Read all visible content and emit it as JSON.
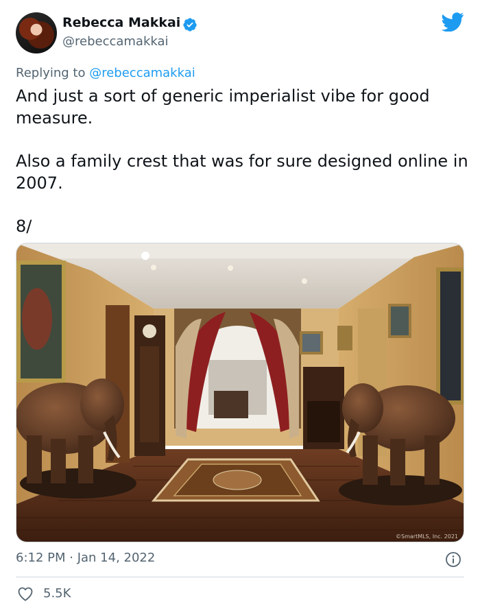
{
  "author": {
    "name": "Rebecca Makkai",
    "handle": "@rebeccamakkai"
  },
  "reply": {
    "prefix": "Replying to",
    "mention": "@rebeccamakkai"
  },
  "tweet": {
    "paragraphs": [
      "And just a sort of generic imperialist vibe for good measure.",
      "Also a family crest that was for sure designed online in 2007.",
      "8/"
    ]
  },
  "photo": {
    "watermark": "©SmartMLS, Inc. 2021"
  },
  "meta": {
    "timestamp": "6:12 PM · Jan 14, 2022"
  },
  "engagement": {
    "likes": "5.5K"
  },
  "colors": {
    "accent": "#1d9bf0",
    "secondary_text": "#536471",
    "primary_text": "#0f1419"
  },
  "icons": [
    "verified-icon",
    "twitter-bird-icon",
    "info-icon",
    "heart-icon"
  ]
}
